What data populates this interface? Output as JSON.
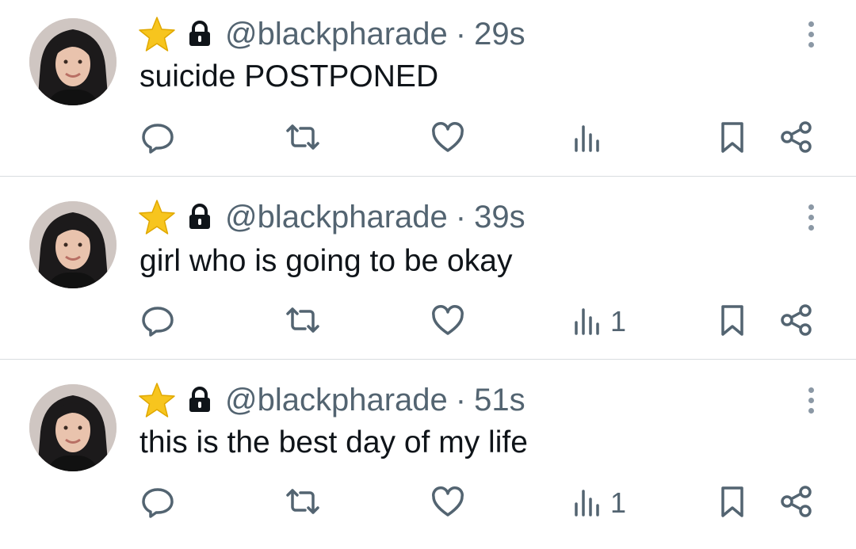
{
  "tweets": [
    {
      "handle": "@blackpharade",
      "separator": "·",
      "time": "29s",
      "text": "suicide POSTPONED",
      "views": ""
    },
    {
      "handle": "@blackpharade",
      "separator": "·",
      "time": "39s",
      "text": "girl who is going to be okay",
      "views": "1"
    },
    {
      "handle": "@blackpharade",
      "separator": "·",
      "time": "51s",
      "text": "this is the best day of my life",
      "views": "1"
    }
  ],
  "colors": {
    "text": "#0f1419",
    "secondary": "#536471",
    "divider": "#d9dde0",
    "star": "#f7c51e"
  },
  "icons": [
    "star-badge-icon",
    "lock-icon",
    "more-icon",
    "reply-icon",
    "retweet-icon",
    "like-icon",
    "views-icon",
    "bookmark-icon",
    "share-icon"
  ]
}
